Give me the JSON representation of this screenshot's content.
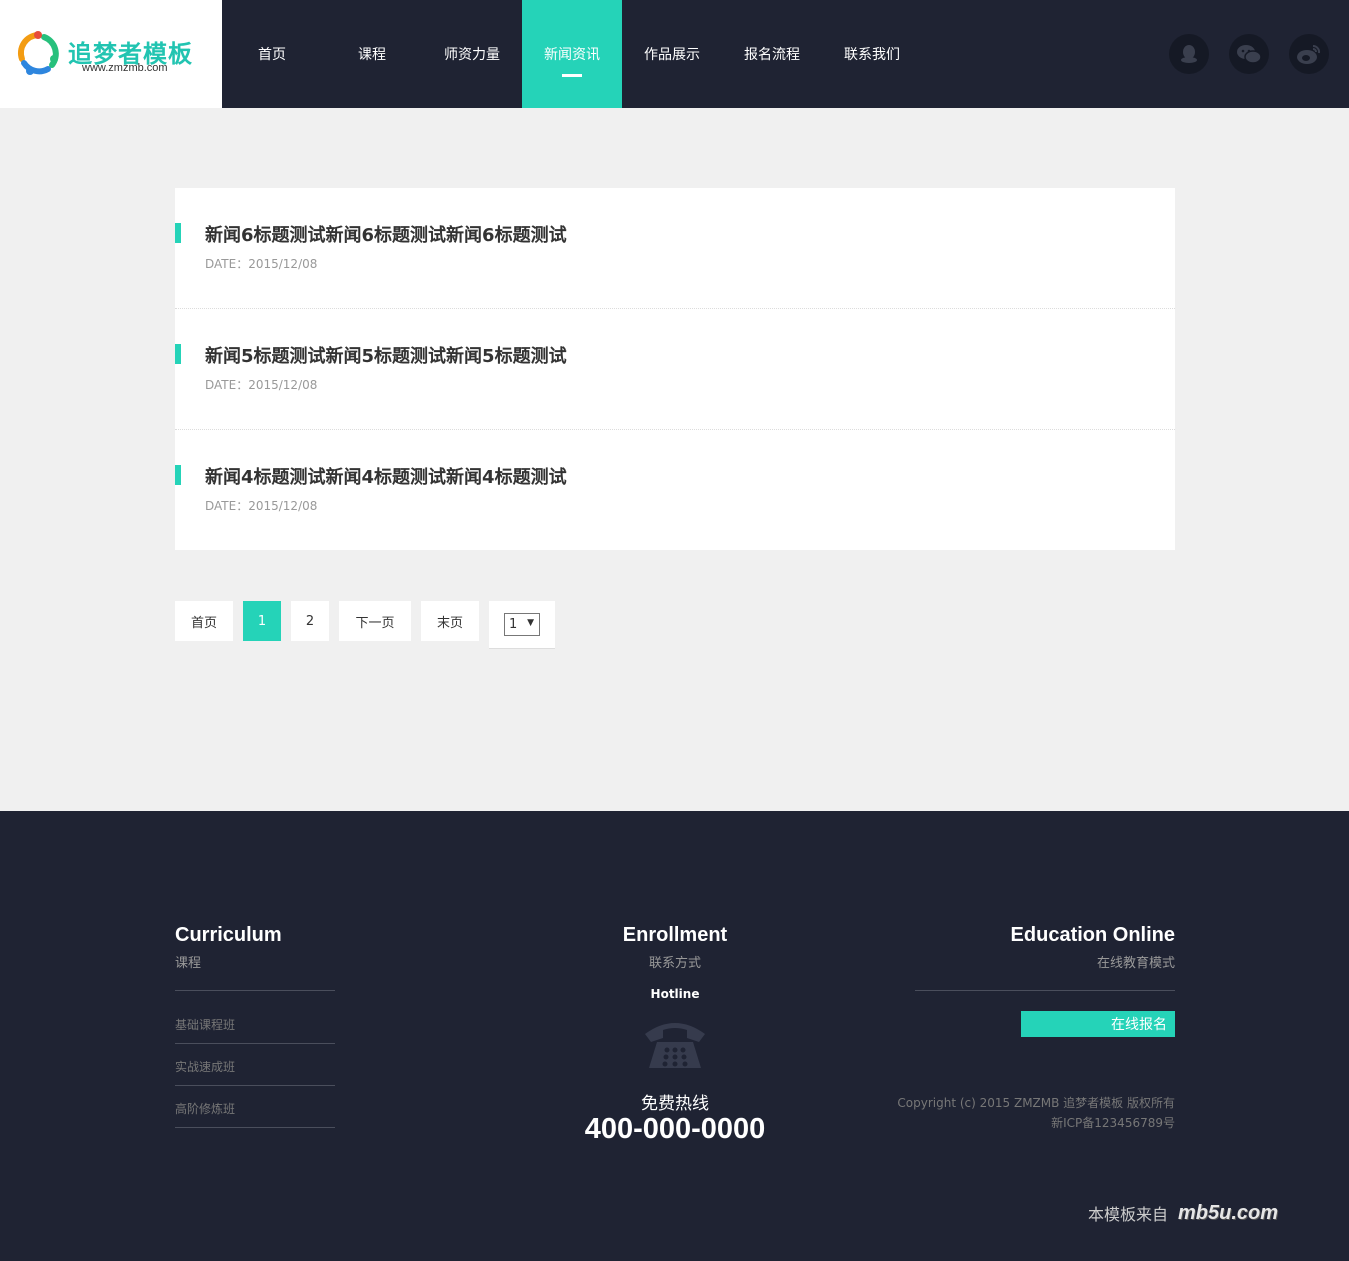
{
  "brand": {
    "title": "追梦者模板",
    "url": "www.zmzmb.com"
  },
  "nav": {
    "items": [
      {
        "label": "首页"
      },
      {
        "label": "课程"
      },
      {
        "label": "师资力量"
      },
      {
        "label": "新闻资讯"
      },
      {
        "label": "作品展示"
      },
      {
        "label": "报名流程"
      },
      {
        "label": "联系我们"
      }
    ],
    "active_index": 3
  },
  "social": [
    "qq-icon",
    "wechat-icon",
    "weibo-icon"
  ],
  "news": [
    {
      "title": "新闻6标题测试新闻6标题测试新闻6标题测试",
      "date": "DATE：2015/12/08"
    },
    {
      "title": "新闻5标题测试新闻5标题测试新闻5标题测试",
      "date": "DATE：2015/12/08"
    },
    {
      "title": "新闻4标题测试新闻4标题测试新闻4标题测试",
      "date": "DATE：2015/12/08"
    }
  ],
  "pagination": {
    "first": "首页",
    "pages": [
      "1",
      "2"
    ],
    "current": "1",
    "next": "下一页",
    "last": "末页",
    "select_value": "1"
  },
  "footer": {
    "curriculum": {
      "heading": "Curriculum",
      "sub": "课程",
      "links": [
        "基础课程班",
        "实战速成班",
        "高阶修炼班"
      ]
    },
    "enrollment": {
      "heading": "Enrollment",
      "sub": "联系方式",
      "hotline_label": "Hotline",
      "free_label": "免费热线",
      "phone": "400-000-0000"
    },
    "online": {
      "heading": "Education Online",
      "sub": "在线教育模式",
      "button": "在线报名",
      "copyright": "Copyright (c) 2015 ZMZMB 追梦者模板 版权所有",
      "icp": "新ICP备123456789号"
    },
    "credit": {
      "text": "本模板来自",
      "logo": "mb5u.com"
    }
  },
  "colors": {
    "accent": "#25d3b8",
    "dark": "#1f2333",
    "page_bg": "#f0f0f0"
  }
}
